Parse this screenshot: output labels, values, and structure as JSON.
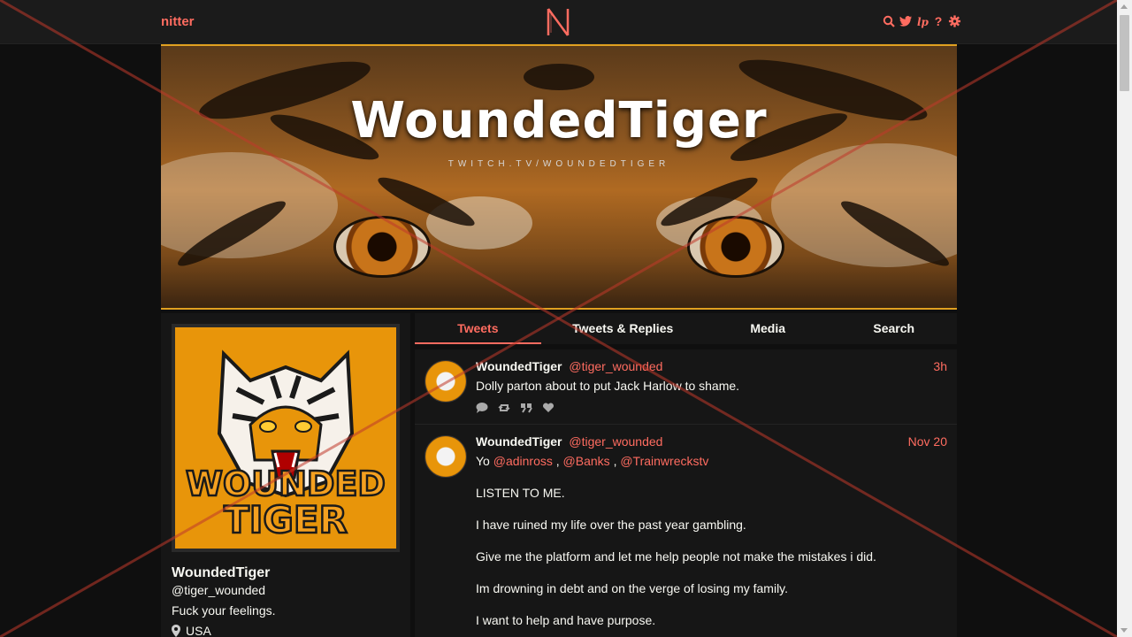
{
  "navbar": {
    "logo_text": "nitter",
    "icons": [
      "search-icon",
      "twitter-bird-icon",
      "liberapay-icon",
      "help-icon",
      "gear-icon"
    ],
    "help_glyph": "?"
  },
  "banner": {
    "title": "WoundedTiger",
    "subtitle": "TWITCH.TV/WOUNDEDTIGER"
  },
  "profile": {
    "avatar_text_line1": "WOUNDED",
    "avatar_text_line2": "TIGER",
    "fullname": "WoundedTiger",
    "username": "@tiger_wounded",
    "bio": "Fuck your feelings.",
    "location": "USA"
  },
  "tabs": [
    {
      "label": "Tweets",
      "active": true
    },
    {
      "label": "Tweets & Replies",
      "active": false
    },
    {
      "label": "Media",
      "active": false
    },
    {
      "label": "Search",
      "active": false
    }
  ],
  "tweets": [
    {
      "fullname": "WoundedTiger",
      "username": "@tiger_wounded",
      "date": "3h",
      "text": "Dolly parton about to put Jack Harlow to shame."
    },
    {
      "fullname": "WoundedTiger",
      "username": "@tiger_wounded",
      "date": "Nov 20",
      "intro": "Yo",
      "mentions": [
        "@adinross",
        "@Banks",
        "@Trainwreckstv"
      ],
      "separator": ",",
      "paragraphs": [
        "LISTEN TO ME.",
        "I have ruined my life over the past year gambling.",
        "Give me the platform and let me help people not make the mistakes i did.",
        "Im drowning in debt and on the verge of losing my family.",
        "I want to help and have purpose."
      ]
    }
  ],
  "colors": {
    "accent": "#ff6c60",
    "background": "#0f0f0f",
    "panel": "#161616",
    "navbar": "#1b1b1b",
    "overlay_x": "#c0392b"
  }
}
